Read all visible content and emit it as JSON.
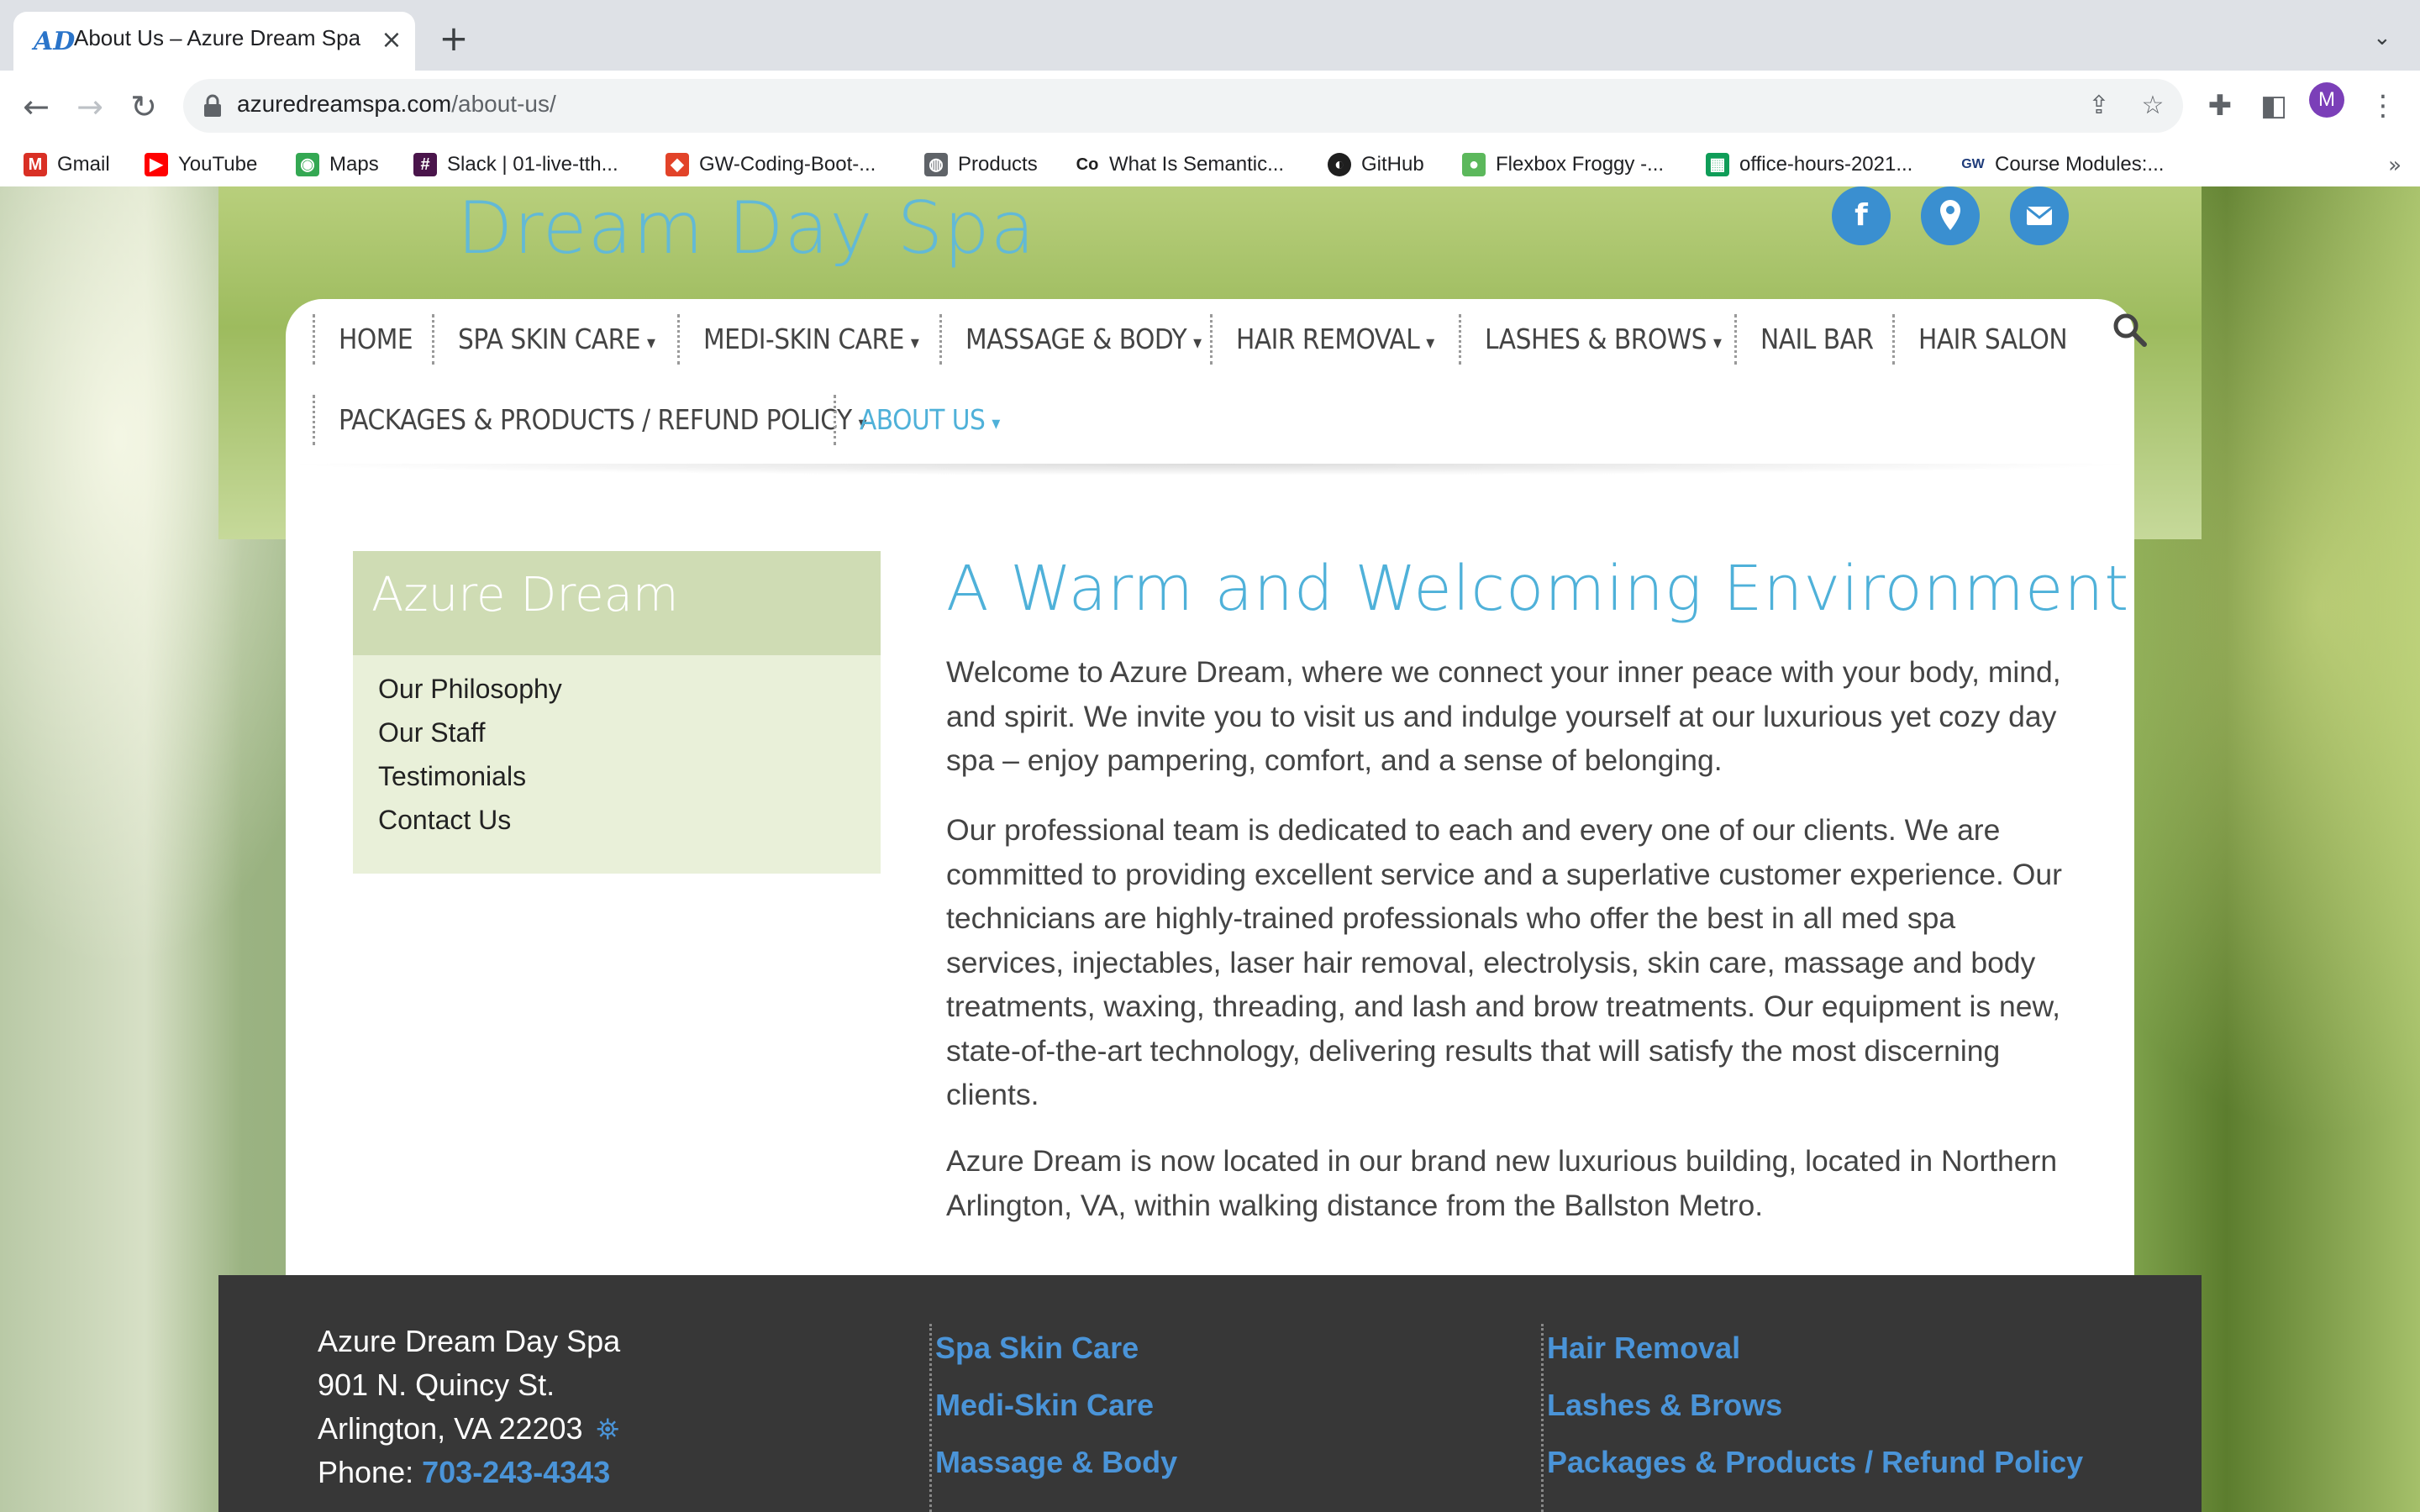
{
  "browser": {
    "tab_title": "About Us – Azure Dream Spa",
    "tab_favicon_text": "AD",
    "url_domain": "azuredreamspa.com",
    "url_path": "/about-us/",
    "profile_initial": "M",
    "bookmarks": [
      {
        "label": "Gmail",
        "icon": "gmail-icon",
        "color": "#d93025"
      },
      {
        "label": "YouTube",
        "icon": "youtube-icon",
        "color": "#ff0000"
      },
      {
        "label": "Maps",
        "icon": "maps-icon",
        "color": "#34a853"
      },
      {
        "label": "Slack | 01-live-tth...",
        "icon": "slack-icon",
        "color": "#4a154b"
      },
      {
        "label": "GW-Coding-Boot-...",
        "icon": "gitlab-icon",
        "color": "#e24329"
      },
      {
        "label": "Products",
        "icon": "globe-icon",
        "color": "#5f6368"
      },
      {
        "label": "What Is Semantic...",
        "icon": "codecademy-icon",
        "color": "#1f1f1f"
      },
      {
        "label": "GitHub",
        "icon": "github-icon",
        "color": "#1f1f1f"
      },
      {
        "label": "Flexbox Froggy -...",
        "icon": "froggy-icon",
        "color": "#5cb85c"
      },
      {
        "label": "office-hours-2021...",
        "icon": "sheets-icon",
        "color": "#0f9d58"
      },
      {
        "label": "Course Modules:...",
        "icon": "gw-icon",
        "color": "#1f3c7a"
      }
    ]
  },
  "site": {
    "logo_text": "Dream Day Spa",
    "accent_color": "#4fb1d9",
    "social": [
      "facebook-icon",
      "map-pin-icon",
      "envelope-icon"
    ],
    "social_glyphs": [
      "f",
      "⬤",
      "✉"
    ],
    "menu": [
      {
        "label": "HOME",
        "has_dropdown": false
      },
      {
        "label": "SPA SKIN CARE",
        "has_dropdown": true
      },
      {
        "label": "MEDI-SKIN CARE",
        "has_dropdown": true
      },
      {
        "label": "MASSAGE & BODY",
        "has_dropdown": true
      },
      {
        "label": "HAIR REMOVAL",
        "has_dropdown": true
      },
      {
        "label": "LASHES & BROWS",
        "has_dropdown": true
      },
      {
        "label": "NAIL BAR",
        "has_dropdown": false
      },
      {
        "label": "HAIR SALON",
        "has_dropdown": false
      },
      {
        "label": "PACKAGES & PRODUCTS / REFUND POLICY",
        "has_dropdown": true
      },
      {
        "label": "ABOUT US",
        "has_dropdown": true,
        "active": true
      }
    ],
    "sidebar": {
      "title": "Azure Dream",
      "links": [
        "Our Philosophy",
        "Our Staff",
        "Testimonials",
        "Contact Us"
      ]
    },
    "main": {
      "heading": "A Warm and Welcoming Environment",
      "paragraphs": [
        "Welcome to Azure Dream, where we connect your inner peace with your body, mind, and spirit. We invite you to visit us and indulge yourself at our luxurious yet cozy day spa – enjoy pampering, comfort, and a sense of belonging.",
        "Our professional team is dedicated to each and every one of our clients. We are committed to providing excellent service and a superlative customer experience. Our technicians are highly-trained professionals who offer the best in all med spa services, injectables, laser hair removal, electrolysis, skin care, massage and body treatments, waxing, threading, and lash and brow treatments. Our equipment is new, state-of-the-art technology, delivering results that will satisfy the most discerning clients.",
        "Azure Dream is now located in our brand new luxurious building, located in Northern Arlington, VA, within walking distance from the Ballston Metro."
      ]
    },
    "footer": {
      "name": "Azure Dream Day Spa",
      "street": "901 N. Quincy St.",
      "city": "Arlington, VA 22203",
      "phone_label": "Phone:",
      "phone": "703-243-4343",
      "col1": [
        "Spa Skin Care",
        "Medi-Skin Care",
        "Massage & Body"
      ],
      "col2": [
        "Hair Removal",
        "Lashes & Brows",
        "Packages & Products / Refund Policy"
      ]
    }
  }
}
